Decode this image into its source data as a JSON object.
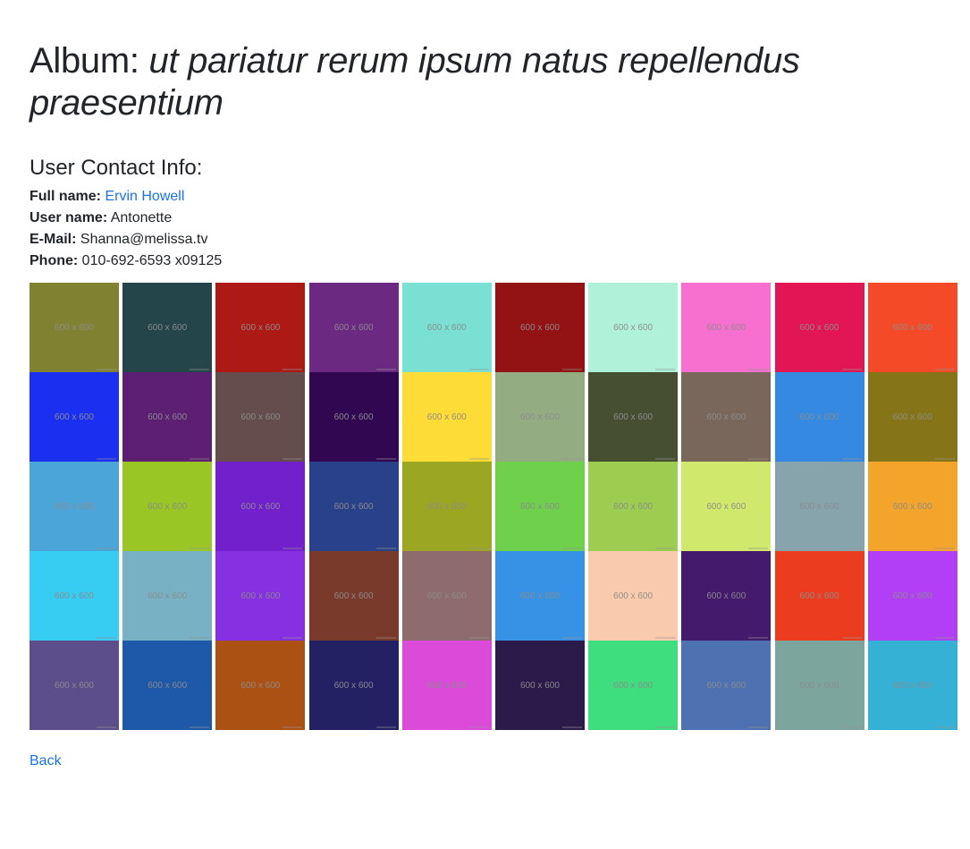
{
  "page": {
    "title_prefix": "Album: ",
    "album_title": "ut pariatur rerum ipsum natus repellendus praesentium",
    "contact_heading": "User Contact Info:"
  },
  "contact": {
    "full_name_label": "Full name:",
    "full_name_value": "Ervin Howell",
    "user_name_label": "User name:",
    "user_name_value": "Antonette",
    "email_label": "E-Mail:",
    "email_value": "Shanna@melissa.tv",
    "phone_label": "Phone:",
    "phone_value": "010-692-6593 x09125"
  },
  "photos": {
    "label": "600 x 600",
    "colors": [
      "#808232",
      "#24464b",
      "#ad1a15",
      "#6c2981",
      "#79e0d3",
      "#931213",
      "#b0f1da",
      "#f770cf",
      "#e21655",
      "#f54a27",
      "#1b2ff0",
      "#5c1f72",
      "#654c4d",
      "#310752",
      "#fddc37",
      "#93ac81",
      "#474f33",
      "#7a675c",
      "#3689e1",
      "#867518",
      "#4ca5d8",
      "#99c624",
      "#7120cb",
      "#294188",
      "#9ba722",
      "#6ed04b",
      "#9ccd51",
      "#d0e96d",
      "#87a4ad",
      "#f3a42a",
      "#37ccf2",
      "#78b1c4",
      "#8730e1",
      "#7a3a2b",
      "#8e6b6c",
      "#3792e5",
      "#facaad",
      "#441a6d",
      "#eb3c1f",
      "#b23ff6",
      "#5b4e8b",
      "#1e58a9",
      "#ab5114",
      "#232164",
      "#db4ad9",
      "#2a1b4b",
      "#3edd7e",
      "#4e71b1",
      "#7ca59d",
      "#35b1d5"
    ]
  },
  "nav": {
    "back_label": "Back"
  }
}
